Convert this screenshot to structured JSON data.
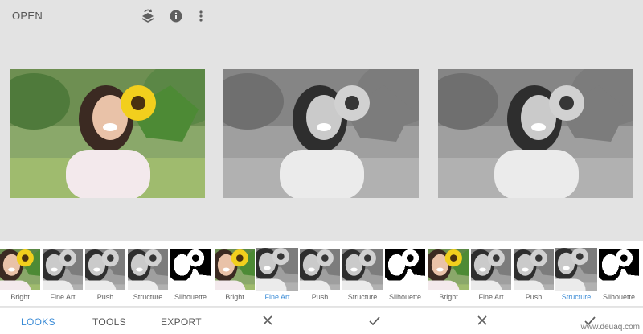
{
  "screen1": {
    "toolbar": {
      "open_label": "OPEN",
      "icons": [
        "layers-undo-icon",
        "info-icon",
        "more-vert-icon"
      ]
    },
    "looks": [
      {
        "label": "Bright",
        "style": "color"
      },
      {
        "label": "Fine Art",
        "style": "bw"
      },
      {
        "label": "Push",
        "style": "bw"
      },
      {
        "label": "Structure",
        "style": "bw"
      },
      {
        "label": "Silhouette",
        "style": "sketch"
      }
    ],
    "tabs": [
      {
        "label": "LOOKS",
        "active": true
      },
      {
        "label": "TOOLS",
        "active": false
      },
      {
        "label": "EXPORT",
        "active": false
      }
    ]
  },
  "screen2": {
    "selected_look": "Fine Art",
    "looks": [
      {
        "label": "Bright",
        "style": "color"
      },
      {
        "label": "Fine Art",
        "style": "bw",
        "selected": true
      },
      {
        "label": "Push",
        "style": "bw"
      },
      {
        "label": "Structure",
        "style": "bw"
      },
      {
        "label": "Silhouette",
        "style": "sketch"
      }
    ],
    "actions": [
      "close-icon",
      "check-icon"
    ]
  },
  "screen3": {
    "selected_look": "Structure",
    "looks": [
      {
        "label": "Bright",
        "style": "color"
      },
      {
        "label": "Fine Art",
        "style": "bw"
      },
      {
        "label": "Push",
        "style": "bw"
      },
      {
        "label": "Structure",
        "style": "bw",
        "selected": true
      },
      {
        "label": "Silhouette",
        "style": "sketch"
      }
    ],
    "actions": [
      "close-icon",
      "check-icon"
    ]
  },
  "watermark": "www.deuaq.com",
  "colors": {
    "accent": "#3a8bd6",
    "background": "#e3e3e3",
    "text": "#555555"
  }
}
